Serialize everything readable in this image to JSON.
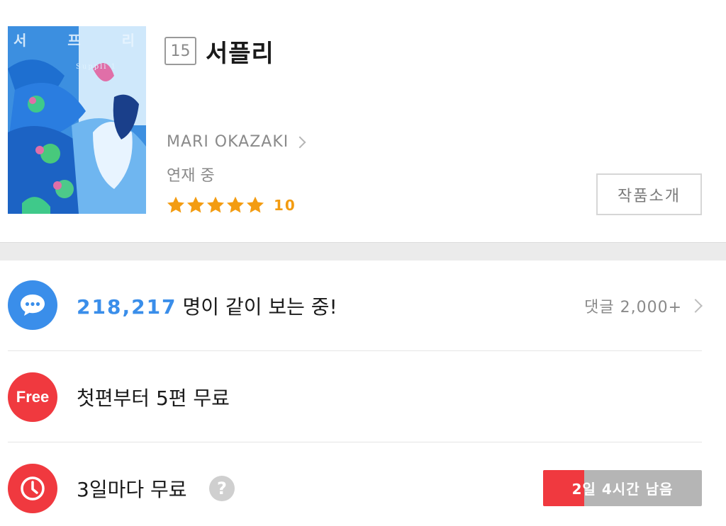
{
  "work": {
    "cover_title": [
      "서",
      "프",
      "리"
    ],
    "cover_subtitle": "Suppli 1",
    "age_rating": "15",
    "title": "서플리",
    "author": "MARI OKAZAKI",
    "status": "연재 중",
    "rating": {
      "value": "10",
      "stars": 5
    },
    "intro_button": "작품소개"
  },
  "viewers": {
    "count": "218,217",
    "text": "명이 같이 보는 중!",
    "comments": "댓글 2,000+",
    "icon": "chat-bubble-icon"
  },
  "free_first": {
    "badge": "Free",
    "text": "첫편부터 5편 무료"
  },
  "wait_free": {
    "text": "3일마다 무료",
    "help": "?",
    "timer_label": "2일 4시간 남음",
    "timer_progress": 0.26,
    "icon": "clock-icon"
  },
  "colors": {
    "accent_blue": "#3a8eea",
    "accent_red": "#f0393f",
    "star": "#f39c12"
  }
}
